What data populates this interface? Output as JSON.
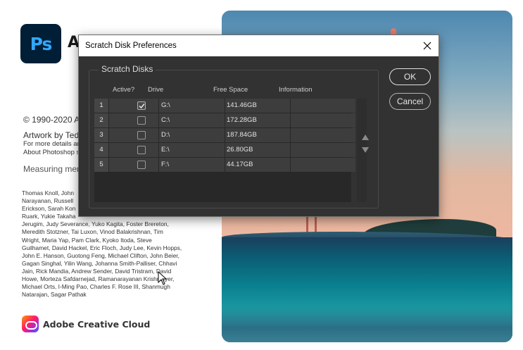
{
  "splash": {
    "logo_text": "Ps",
    "app_title": "Ad",
    "copyright": "© 1990-2020 A",
    "artwork": "Artwork by Ted",
    "more_details": "For more details an",
    "about": "About Photoshop s",
    "measuring": "Measuring men",
    "credits": [
      "Thomas Knoll, John",
      "Narayanan, Russell",
      "Erickson, Sarah Kon",
      "Ruark, Yukie Takaha",
      "Jerugim, Judy Severance, Yuko Kagita, Foster Brereton,",
      "Meredith Stotzner, Tai Luxon, Vinod Balakrishnan, Tim",
      "Wright, Maria Yap, Pam Clark, Kyoko Itoda, Steve",
      "Guilhamet, David Hackel, Eric Floch, Judy Lee, Kevin Hopps,",
      "John E. Hanson, Guotong Feng, Michael Clifton, John Beier,",
      "Gagan Singhal, Yilin Wang, Johanna Smith-Palliser, Chhavi",
      "Jain, Rick Mandia, Andrew Sender, David Tristram, David",
      "Howe, Morteza Safdarnejad, Ramanarayanan Krishnaiyer,",
      "Michael Orts, I-Ming Pao, Charles F. Rose III, Shanmugh",
      "Natarajan, Sagar Pathak"
    ],
    "cc_label": "Adobe Creative Cloud"
  },
  "dialog": {
    "title": "Scratch Disk Preferences",
    "group_label": "Scratch Disks",
    "columns": {
      "active": "Active?",
      "drive": "Drive",
      "free_space": "Free Space",
      "information": "Information"
    },
    "rows": [
      {
        "index": "1",
        "active": true,
        "drive": "G:\\",
        "free_space": "141.46GB",
        "information": ""
      },
      {
        "index": "2",
        "active": false,
        "drive": "C:\\",
        "free_space": "172.28GB",
        "information": ""
      },
      {
        "index": "3",
        "active": false,
        "drive": "D:\\",
        "free_space": "187.84GB",
        "information": ""
      },
      {
        "index": "4",
        "active": false,
        "drive": "E:\\",
        "free_space": "26.80GB",
        "information": ""
      },
      {
        "index": "5",
        "active": false,
        "drive": "F:\\",
        "free_space": "44.17GB",
        "information": ""
      }
    ],
    "ok_label": "OK",
    "cancel_label": "Cancel"
  },
  "colors": {
    "dialog_bg": "#323232",
    "row_bg": "#3d3d3d",
    "ps_logo_bg": "#001e36",
    "ps_logo_text": "#31a8ff"
  },
  "icons": [
    "close-icon",
    "checkmark-icon",
    "move-up-arrow-icon",
    "move-down-arrow-icon",
    "creative-cloud-icon",
    "mouse-cursor-icon"
  ]
}
